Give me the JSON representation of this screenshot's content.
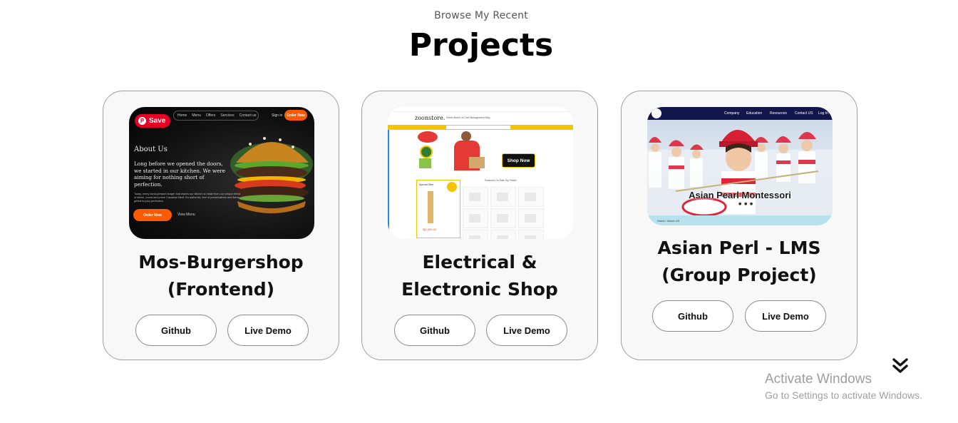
{
  "header": {
    "eyebrow": "Browse My Recent",
    "title": "Projects"
  },
  "projects": [
    {
      "title_line1": "Mos-Burgershop",
      "title_line2": "(Frontend)",
      "github_label": "Github",
      "demo_label": "Live Demo",
      "thumbnail": {
        "pin_label": "Save",
        "nav_items": [
          "Home",
          "Menu",
          "Offers",
          "Services",
          "Contact us"
        ],
        "sign_in": "Sign in",
        "order_now": "Order Now",
        "heading": "About Us",
        "text": "Long before we opened the doors, we started in our kitchen. We were aiming for nothing short of perfection.",
        "small_text": "Today, every hand-pressed burger that leaves our kitchen is made from our unique blend of sirloin, round and prime Canadian Beef. It's authentic, free of preservatives and flame-grilled to juicy perfection.",
        "order_now_2": "Order Now",
        "view_menu": "View Menu"
      }
    },
    {
      "title_line1": "Electrical &",
      "title_line2": "Electronic Shop",
      "github_label": "Github",
      "demo_label": "Live Demo",
      "thumbnail": {
        "logo": "zoonstore.",
        "menu": "Home   About Us   Cart   Management   Blog",
        "shop_now": "Shop Now",
        "special_offer": "Special Offer",
        "price": "රු1,200.00",
        "tabs": "Featured   On Sale   Top Rated"
      }
    },
    {
      "title_line1": "Asian Perl - LMS",
      "title_line2": "(Group Project)",
      "github_label": "Github",
      "demo_label": "Live Demo",
      "thumbnail": {
        "nav_items": [
          "Company",
          "Education",
          "Resources",
          "Contact US",
          "Log In"
        ],
        "banner": "Asian Pearl Montessori",
        "dots": "● ● ●",
        "breadcrumb": "Home › About US"
      }
    }
  ],
  "watermark": {
    "title": "Activate Windows",
    "subtitle": "Go to Settings to activate Windows."
  },
  "icons": {
    "scroll_down": "double-chevron-down-icon"
  }
}
